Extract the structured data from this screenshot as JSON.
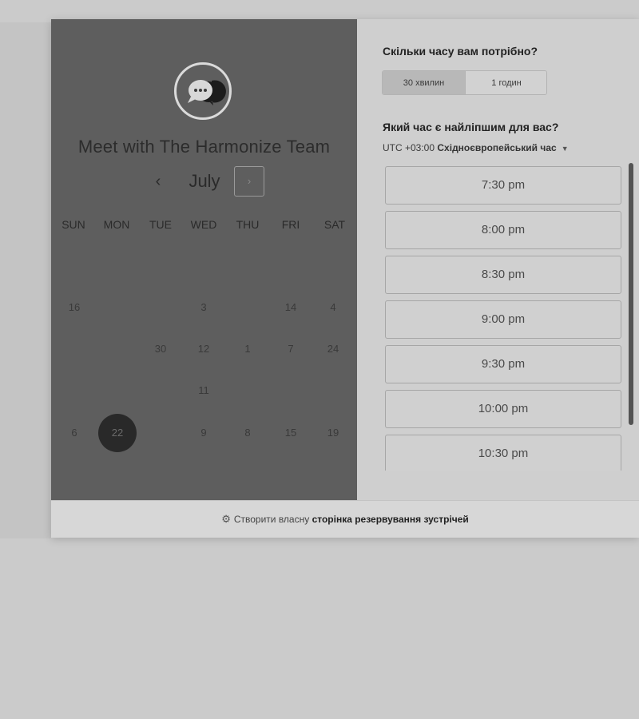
{
  "calendar": {
    "title": "Meet with The Harmonize Team",
    "month": "July",
    "prev_icon": "‹",
    "next_icon": "›",
    "weekdays": [
      "SUN",
      "MON",
      "TUE",
      "WED",
      "THU",
      "FRI",
      "SAT"
    ],
    "days": {
      "sun_1": "16",
      "wed_1": "3",
      "fri_1": "14",
      "sat_1": "4",
      "tue_2": "30",
      "wed_2": "12",
      "thu_2": "1",
      "fri_2": "7",
      "sat_2": "24",
      "wed_3": "11",
      "sun_4": "6",
      "mon_4": "22",
      "wed_4": "9",
      "thu_4": "8",
      "fri_4": "15",
      "sat_4": "19"
    },
    "selected_day": "22",
    "avatar_icon": "chat-bubble-icon"
  },
  "booking": {
    "duration_question": "Скільки часу вам потрібно?",
    "durations": [
      "30 хвилин",
      "1 годин"
    ],
    "active_duration": "30 хвилин",
    "time_question": "Який час є найліпшим для вас?",
    "timezone_offset": "UTC +03:00",
    "timezone_name": "Східноєвропейський час",
    "slots": [
      "7:30 pm",
      "8:00 pm",
      "8:30 pm",
      "9:00 pm",
      "9:30 pm",
      "10:00 pm",
      "10:30 pm"
    ]
  },
  "footer": {
    "prefix": "Створити власну",
    "link": "сторінка резервування зустрічей",
    "icon": "hubspot-sprocket-icon"
  }
}
